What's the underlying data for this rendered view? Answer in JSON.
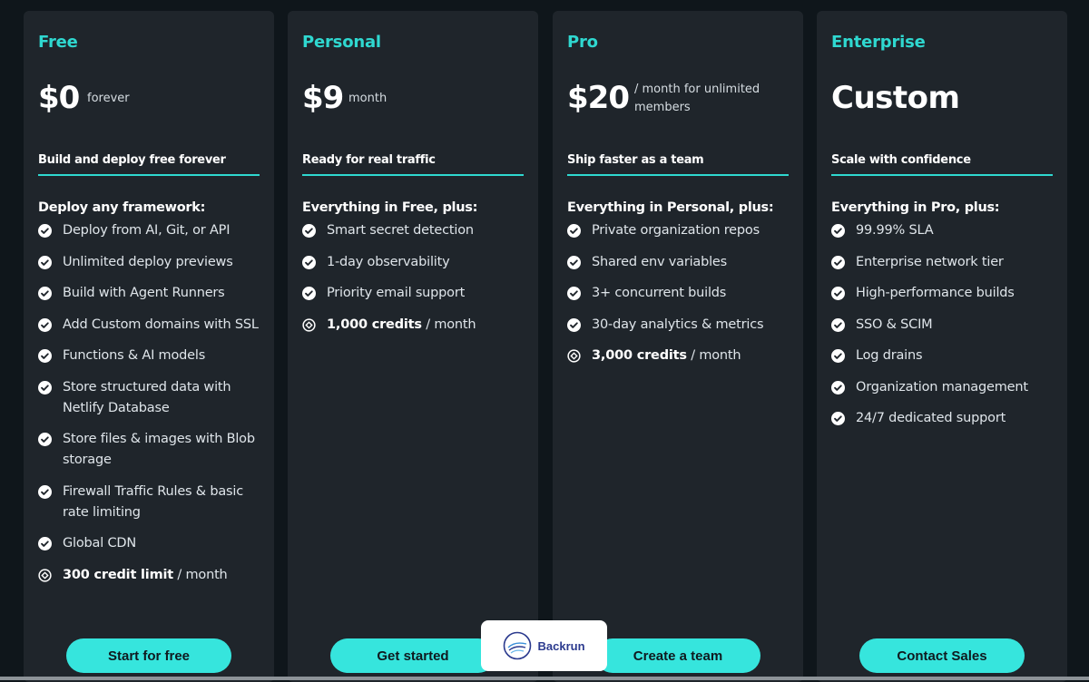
{
  "plans": [
    {
      "name": "Free",
      "price": "$0",
      "period": "forever",
      "tagline": "Build and deploy free forever",
      "features_title": "Deploy any framework:",
      "features": [
        "Deploy from AI, Git, or API",
        "Unlimited deploy previews",
        "Build with Agent Runners",
        "Add Custom domains with SSL",
        "Functions & AI models",
        "Store structured data with Netlify Database",
        "Store files & images with Blob storage",
        "Firewall Traffic Rules & basic rate limiting",
        "Global CDN"
      ],
      "credit": {
        "strong": "300 credit limit",
        "suffix": " / month"
      },
      "cta": "Start for free"
    },
    {
      "name": "Personal",
      "price": "$9",
      "period": "month",
      "tagline": "Ready for real traffic",
      "features_title": "Everything in Free, plus:",
      "features": [
        "Smart secret detection",
        "1-day observability",
        "Priority email support"
      ],
      "credit": {
        "strong": "1,000 credits",
        "suffix": " / month"
      },
      "cta": "Get started"
    },
    {
      "name": "Pro",
      "price": "$20",
      "period": "/ month for unlimited members",
      "tagline": "Ship faster as a team",
      "features_title": "Everything in Personal, plus:",
      "features": [
        "Private organization repos",
        "Shared env variables",
        "3+ concurrent builds",
        "30-day analytics & metrics"
      ],
      "credit": {
        "strong": "3,000 credits",
        "suffix": " / month"
      },
      "cta": "Create a team"
    },
    {
      "name": "Enterprise",
      "price": "Custom",
      "period": "",
      "tagline": "Scale with confidence",
      "features_title": "Everything in Pro, plus:",
      "features": [
        "99.99% SLA",
        "Enterprise network tier",
        "High-performance builds",
        "SSO & SCIM",
        "Log drains",
        "Organization management",
        "24/7 dedicated support"
      ],
      "cta": "Contact Sales"
    }
  ],
  "badge": {
    "text": "Backrun"
  },
  "colors": {
    "accent": "#2fd8d0",
    "button": "#36e5dd",
    "card": "#1f252b",
    "background": "#0f161b"
  },
  "icons": {
    "feature": "check-circle-icon",
    "credit": "credit-coin-icon"
  }
}
